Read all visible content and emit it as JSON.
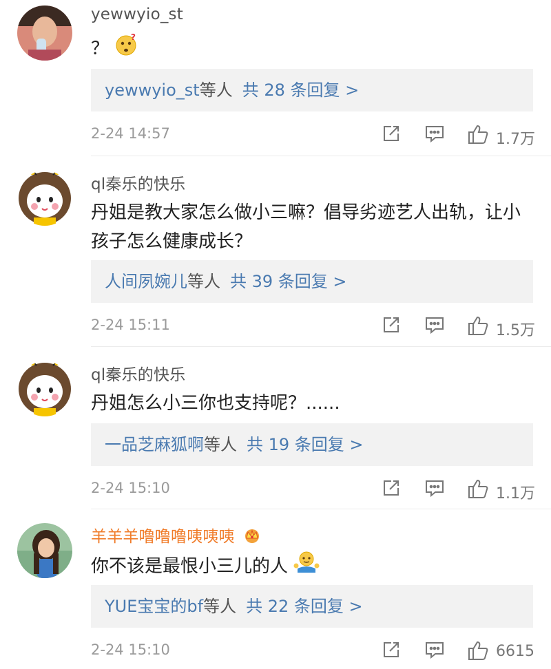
{
  "comments": [
    {
      "username": "yewwyio_st",
      "text": "？",
      "reply_names": "yewwyio_st",
      "reply_etc": "等人",
      "reply_total": "共 28 条回复 >",
      "time": "2-24 14:57",
      "likes": "1.7万"
    },
    {
      "username": "ql秦乐的快乐",
      "text": "丹姐是教大家怎么做小三嘛？倡导劣迹艺人出轨，让小孩子怎么健康成长？",
      "reply_names": "人间夙婉儿",
      "reply_etc": "等人",
      "reply_total": "共 39 条回复 >",
      "time": "2-24 15:11",
      "likes": "1.5万"
    },
    {
      "username": "ql秦乐的快乐",
      "text": "丹姐怎么小三你也支持呢？......",
      "reply_names": "一品芝麻狐啊",
      "reply_etc": "等人",
      "reply_total": "共 19 条回复 >",
      "time": "2-24 15:10",
      "likes": "1.1万"
    },
    {
      "username": "羊羊羊噜噜噜咦咦咦",
      "text": "你不该是最恨小三儿的人",
      "reply_names": "YUE宝宝的bf",
      "reply_etc": "等人",
      "reply_total": "共 22 条回复 >",
      "time": "2-24 15:10",
      "likes": "6615"
    }
  ],
  "colors": {
    "link_blue": "#4a7ab0",
    "vip_orange": "#f07c2a",
    "reply_bg": "#f2f2f2",
    "meta_gray": "#9a9a9a"
  },
  "icons": [
    "share-icon",
    "comment-icon",
    "thumbs-up-icon",
    "thinking-emoji-icon",
    "shrug-emoji-icon",
    "crown-icon"
  ]
}
